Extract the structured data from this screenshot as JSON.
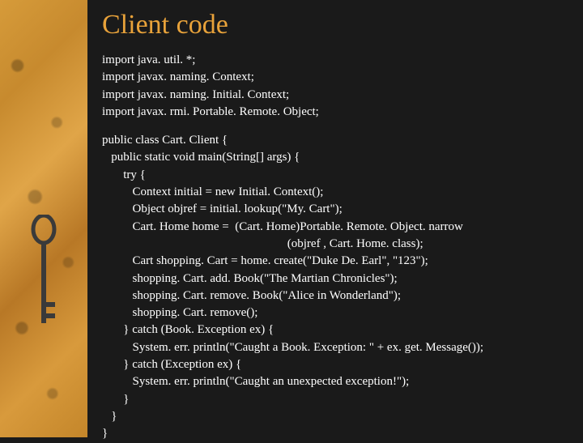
{
  "title": "Client code",
  "imports": [
    "import java. util. *;",
    "import javax. naming. Context;",
    "import javax. naming. Initial. Context;",
    "import javax. rmi. Portable. Remote. Object;"
  ],
  "body": [
    "public class Cart. Client {",
    "   public static void main(String[] args) {",
    "       try {",
    "          Context initial = new Initial. Context();",
    "          Object objref = initial. lookup(\"My. Cart\");",
    "          Cart. Home home =  (Cart. Home)Portable. Remote. Object. narrow",
    "                                                             (objref , Cart. Home. class);",
    "          Cart shopping. Cart = home. create(\"Duke De. Earl\", \"123\");",
    "          shopping. Cart. add. Book(\"The Martian Chronicles\");",
    "          shopping. Cart. remove. Book(\"Alice in Wonderland\");",
    "          shopping. Cart. remove();",
    "       } catch (Book. Exception ex) {",
    "          System. err. println(\"Caught a Book. Exception: \" + ex. get. Message());",
    "       } catch (Exception ex) {",
    "          System. err. println(\"Caught an unexpected exception!\");",
    "       }",
    "   }",
    "}"
  ]
}
